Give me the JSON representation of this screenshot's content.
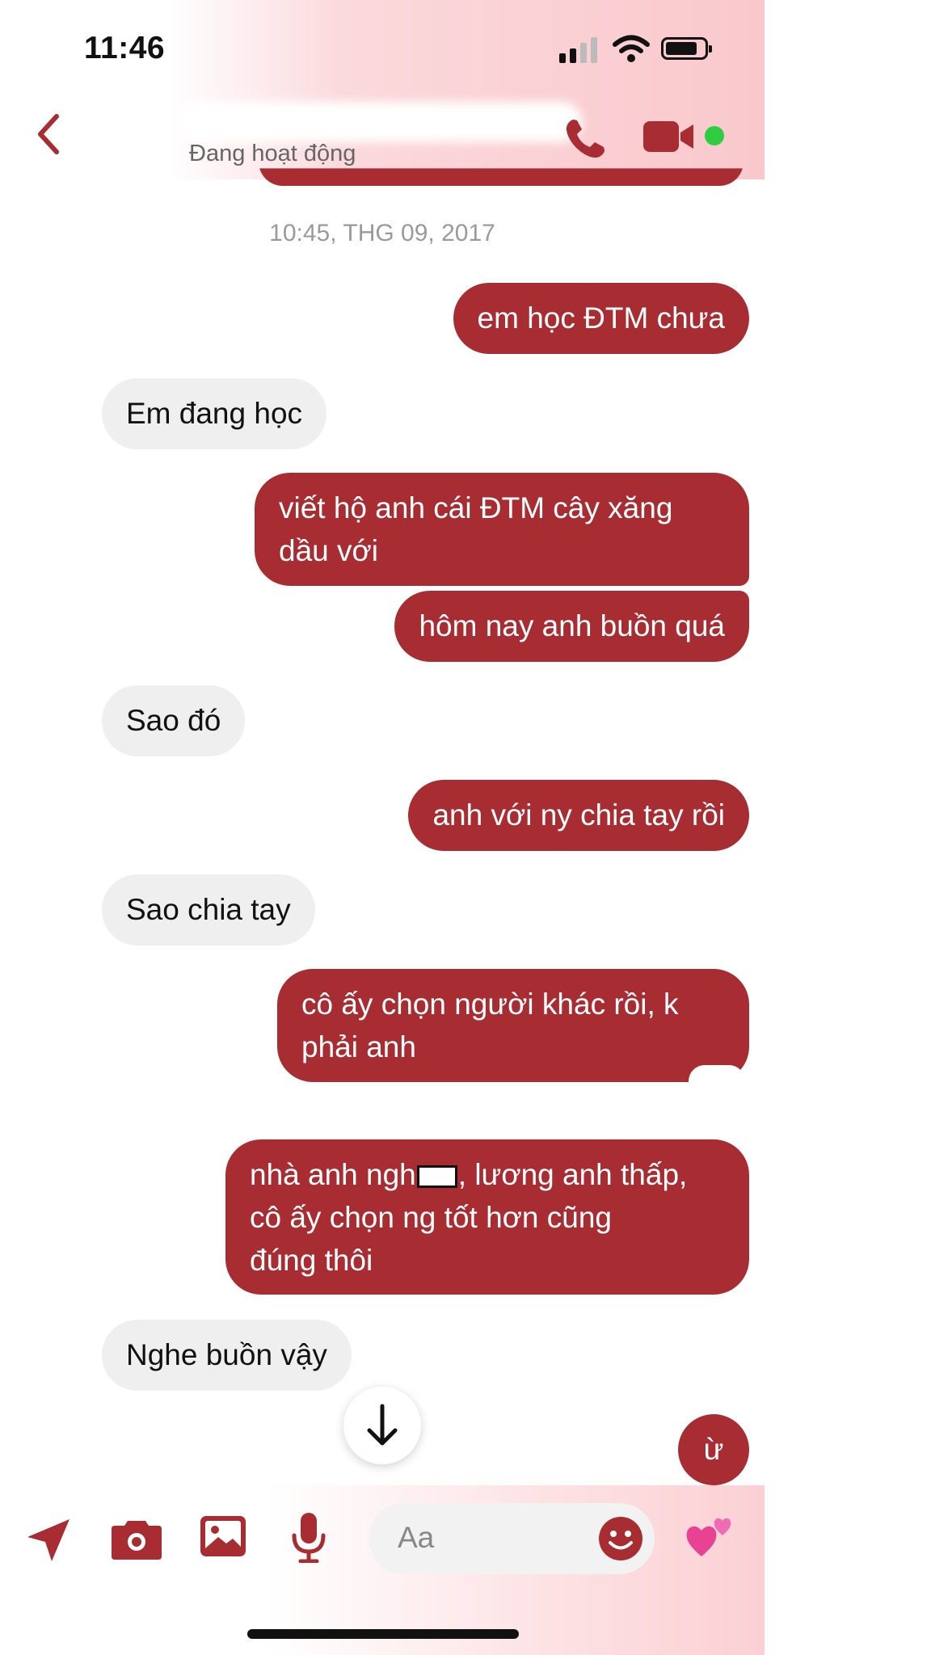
{
  "status_bar": {
    "time": "11:46"
  },
  "header": {
    "contact_status": "Đang hoạt động"
  },
  "conversation": {
    "timestamp": "10:45, THG 09, 2017",
    "messages": [
      {
        "from": "me",
        "text": "em học ĐTM chưa"
      },
      {
        "from": "them",
        "text": "Em đang học"
      },
      {
        "from": "me",
        "lines": [
          "viết hộ anh cái ĐTM cây xăng",
          "dầu với"
        ]
      },
      {
        "from": "me",
        "text": "hôm nay anh buồn quá"
      },
      {
        "from": "them",
        "text": "Sao đó"
      },
      {
        "from": "me",
        "text": "anh với ny chia tay rồi"
      },
      {
        "from": "them",
        "text": "Sao chia tay"
      },
      {
        "from": "me",
        "lines": [
          "cô ấy chọn người khác rồi, k",
          "phải anh"
        ]
      },
      {
        "from": "me",
        "lines": [
          "nhà anh ngh",
          ", lương anh thấp,",
          "cô ấy chọn ng tốt hơn cũng",
          "đúng thôi"
        ]
      },
      {
        "from": "them",
        "text": "Nghe buồn vậy"
      },
      {
        "from": "me",
        "text": "ừ"
      }
    ]
  },
  "composer": {
    "placeholder": "Aa"
  },
  "icons": [
    "back-icon",
    "phone-icon",
    "video-icon",
    "send-location-icon",
    "camera-icon",
    "gallery-icon",
    "microphone-icon",
    "emoji-icon",
    "hearts-icon",
    "arrow-down-icon"
  ],
  "colors": {
    "accent": "#a82d32",
    "incoming_bubble": "#efefef",
    "online": "#2ecc40"
  }
}
